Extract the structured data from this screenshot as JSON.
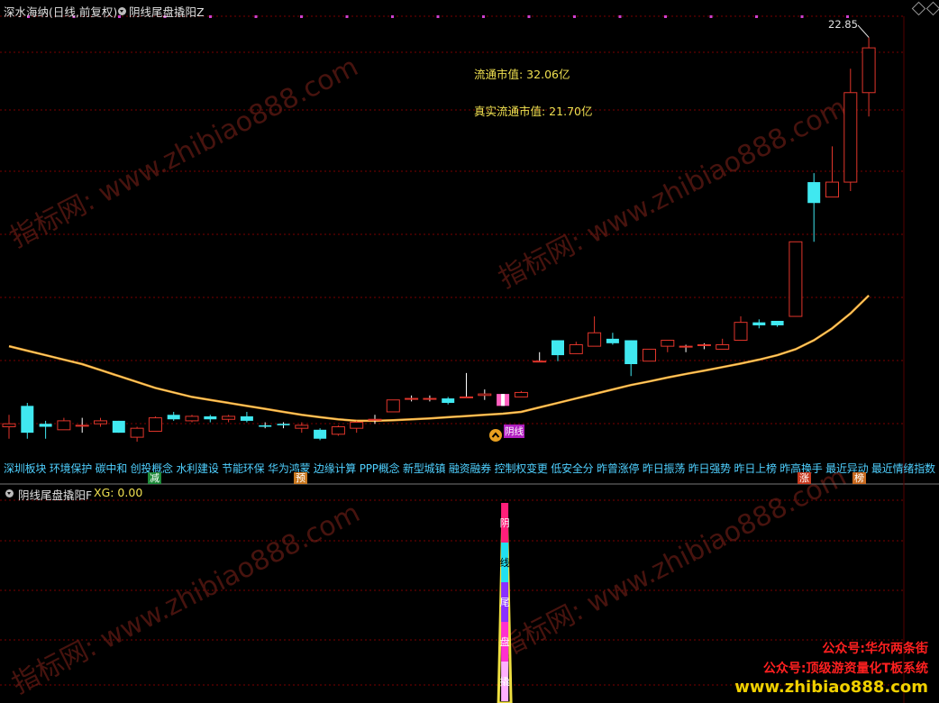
{
  "header": {
    "stock_title": "深水海纳(日线,前复权)",
    "indicator_title": "阴线尾盘撬阳Z"
  },
  "price_label": "22.85",
  "market_cap": {
    "float_cap": "流通市值: 32.06亿",
    "real_float_cap": "真实流通市值: 21.70亿"
  },
  "concepts": "深圳板块 环境保护 碳中和 创投概念 水利建设 节能环保 华为鸿蒙 边缘计算 PPP概念 新型城镇 融资融券 控制权变更 低安全分 昨曾涨停 昨日振荡 昨日强势 昨日上榜 昨高换手 最近异动 最近情绪指数",
  "badges": [
    {
      "text": "减",
      "color": "#1e8a3a"
    },
    {
      "text": "预",
      "color": "#c87820"
    },
    {
      "text": "涨",
      "color": "#c83a20"
    },
    {
      "text": "榜",
      "color": "#c86a20"
    }
  ],
  "signal_label": "阴线",
  "sub_panel": {
    "title": "阴线尾盘撬阳F",
    "xg": "XG: 0.00",
    "bar_chars": [
      "阴",
      "线",
      "尾",
      "盘",
      "撬"
    ]
  },
  "watermarks": [
    "指标网: www.zhibiao888.com",
    "指标网: www.zhibiao888.com",
    "指标网: www.zhibiao888.com",
    "指标网: www.zhibiao888.com"
  ],
  "promo": {
    "line1": "公众号:华尔两条街",
    "line2": "公众号:顶级游资量化T板系统",
    "url": "www.zhibiao888.com"
  },
  "colors": {
    "up": "#e0352b",
    "down": "#40e8f0",
    "ma": "#f0a030",
    "grid": "#7a0000"
  },
  "chart_data": {
    "type": "candlestick",
    "title": "",
    "series": [
      {
        "name": "",
        "values": [
          [
            9.8,
            10.2,
            9.4,
            9.9
          ],
          [
            10.5,
            10.6,
            9.4,
            9.6
          ],
          [
            9.9,
            10.0,
            9.4,
            9.8
          ],
          [
            9.7,
            10.1,
            9.7,
            10.0
          ],
          [
            9.85,
            10.1,
            9.6,
            9.85
          ],
          [
            9.9,
            10.1,
            9.8,
            10.0
          ],
          [
            10.0,
            10.0,
            9.6,
            9.6
          ],
          [
            9.45,
            9.8,
            9.3,
            9.75
          ],
          [
            9.65,
            10.15,
            9.65,
            10.1
          ],
          [
            10.2,
            10.3,
            10.0,
            10.05
          ],
          [
            10.0,
            10.2,
            9.95,
            10.15
          ],
          [
            10.15,
            10.2,
            9.95,
            10.05
          ],
          [
            10.05,
            10.2,
            9.95,
            10.15
          ],
          [
            10.15,
            10.3,
            9.95,
            10.0
          ],
          [
            9.85,
            9.95,
            9.75,
            9.8
          ],
          [
            9.9,
            9.95,
            9.75,
            9.85
          ],
          [
            9.75,
            9.95,
            9.6,
            9.85
          ],
          [
            9.7,
            9.75,
            9.35,
            9.4
          ],
          [
            9.55,
            9.85,
            9.5,
            9.8
          ],
          [
            9.75,
            10.0,
            9.6,
            9.95
          ],
          [
            10.05,
            10.2,
            9.9,
            10.05
          ],
          [
            10.3,
            10.7,
            10.3,
            10.7
          ],
          [
            10.75,
            10.85,
            10.65,
            10.75
          ],
          [
            10.75,
            10.85,
            10.65,
            10.75
          ],
          [
            10.75,
            10.8,
            10.55,
            10.6
          ],
          [
            10.8,
            11.6,
            10.8,
            10.8
          ],
          [
            10.85,
            11.05,
            10.7,
            10.9
          ],
          [
            10.9,
            10.9,
            10.5,
            10.5
          ],
          [
            10.8,
            11.0,
            10.8,
            10.95
          ],
          [
            12.0,
            12.3,
            12.0,
            12.0
          ],
          [
            12.7,
            12.7,
            12.0,
            12.2
          ],
          [
            12.25,
            12.65,
            12.25,
            12.55
          ],
          [
            12.5,
            13.5,
            12.5,
            12.95
          ],
          [
            12.75,
            12.95,
            12.55,
            12.6
          ],
          [
            12.7,
            12.7,
            11.5,
            11.9
          ],
          [
            12.0,
            12.4,
            12.0,
            12.4
          ],
          [
            12.5,
            12.7,
            12.3,
            12.7
          ],
          [
            12.5,
            12.55,
            12.3,
            12.5
          ],
          [
            12.55,
            12.6,
            12.4,
            12.55
          ],
          [
            12.4,
            12.75,
            12.4,
            12.55
          ],
          [
            12.7,
            13.5,
            12.7,
            13.3
          ],
          [
            13.3,
            13.4,
            13.1,
            13.2
          ],
          [
            13.35,
            13.35,
            13.15,
            13.2
          ],
          [
            13.5,
            16.0,
            13.5,
            16.0
          ],
          [
            18.0,
            18.3,
            16.0,
            17.3
          ],
          [
            17.5,
            19.2,
            17.5,
            18.0
          ],
          [
            18.0,
            21.8,
            17.7,
            21.0
          ],
          [
            21.0,
            22.85,
            20.2,
            22.5
          ]
        ]
      }
    ],
    "moving_average": [
      12.5,
      12.35,
      12.2,
      12.05,
      11.9,
      11.7,
      11.5,
      11.3,
      11.1,
      10.95,
      10.8,
      10.7,
      10.6,
      10.5,
      10.4,
      10.3,
      10.2,
      10.12,
      10.05,
      10.0,
      10.0,
      10.02,
      10.05,
      10.08,
      10.12,
      10.16,
      10.2,
      10.24,
      10.3,
      10.45,
      10.6,
      10.75,
      10.9,
      11.05,
      11.2,
      11.32,
      11.45,
      11.57,
      11.68,
      11.8,
      11.92,
      12.05,
      12.2,
      12.4,
      12.7,
      13.1,
      13.6,
      14.2
    ],
    "signal_bar_index": 27,
    "ylim": [
      9.0,
      23.5
    ]
  }
}
